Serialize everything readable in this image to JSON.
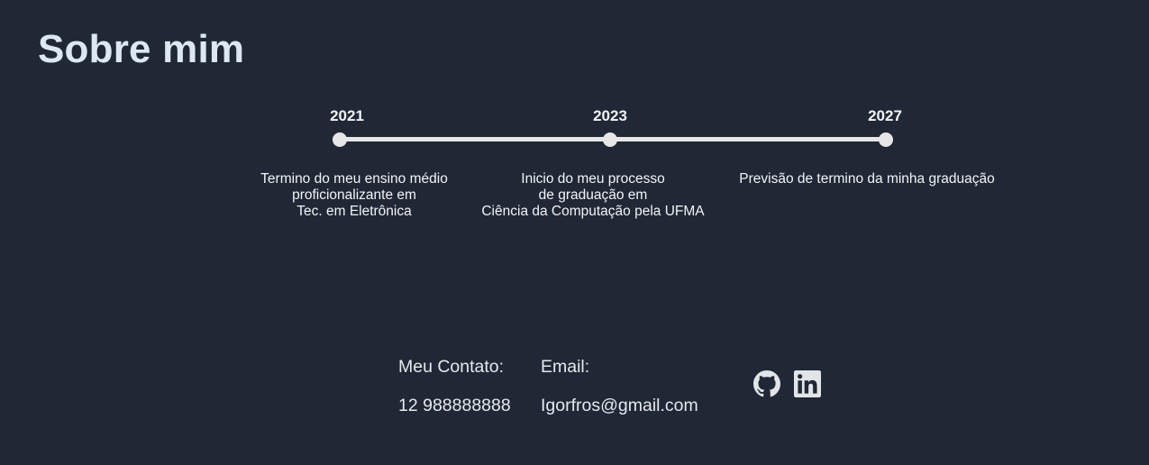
{
  "section": {
    "title": "Sobre mim"
  },
  "timeline": [
    {
      "year": "2021",
      "desc": [
        "Termino do meu ensino médio",
        "proficionalizante em",
        "Tec. em Eletrônica"
      ]
    },
    {
      "year": "2023",
      "desc": [
        "Inicio do meu processo",
        "de graduação em",
        "Ciência da Computação pela UFMA"
      ]
    },
    {
      "year": "2027",
      "desc": [
        "Previsão de termino da minha graduação"
      ]
    }
  ],
  "contact": {
    "label": "Meu Contato:",
    "phone": "12 988888888",
    "email_label": "Email:",
    "email": "Igorfros@gmail.com"
  },
  "social": {
    "icons": [
      "github-icon",
      "linkedin-icon"
    ]
  },
  "colors": {
    "background": "#202735",
    "text": "#e6e9ee",
    "timeline": "#e7e7e7"
  }
}
